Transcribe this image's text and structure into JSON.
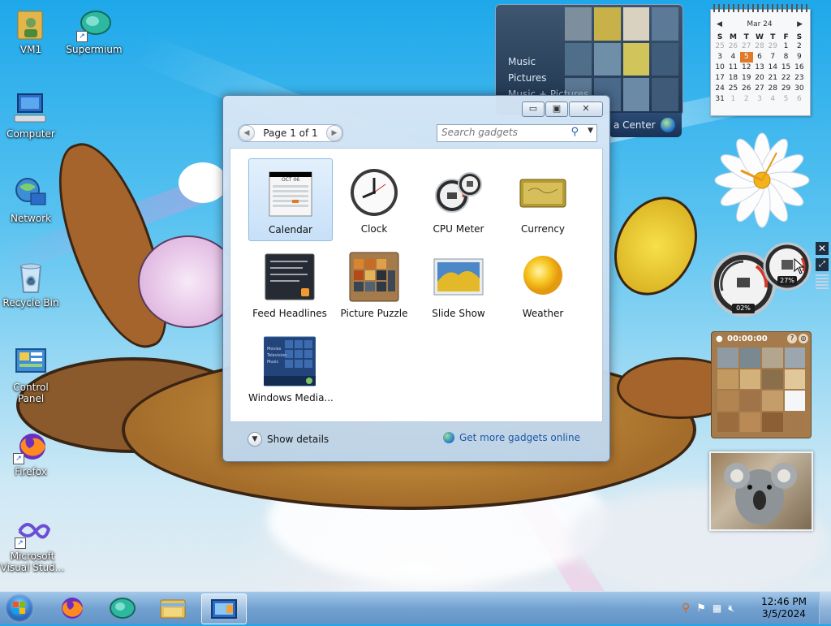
{
  "desktop_icons": [
    {
      "name": "desktop-icon-vm1",
      "label": "VM1"
    },
    {
      "name": "desktop-icon-supermium",
      "label": "Supermium"
    },
    {
      "name": "desktop-icon-computer",
      "label": "Computer"
    },
    {
      "name": "desktop-icon-network",
      "label": "Network"
    },
    {
      "name": "desktop-icon-recycle-bin",
      "label": "Recycle Bin"
    },
    {
      "name": "desktop-icon-control-panel",
      "label": "Control Panel"
    },
    {
      "name": "desktop-icon-firefox",
      "label": "Firefox"
    },
    {
      "name": "desktop-icon-visual-studio",
      "label": "Microsoft Visual Stud..."
    }
  ],
  "media_center_gadget": {
    "items": [
      "Music",
      "Pictures",
      "Music + Pictures"
    ],
    "brand": "a Center"
  },
  "calendar_gadget": {
    "month_label": "Mar 24",
    "weekday_headers": [
      "S",
      "M",
      "T",
      "W",
      "T",
      "F",
      "S"
    ],
    "weeks": [
      [
        "25",
        "26",
        "27",
        "28",
        "29",
        "1",
        "2"
      ],
      [
        "3",
        "4",
        "5",
        "6",
        "7",
        "8",
        "9"
      ],
      [
        "10",
        "11",
        "12",
        "13",
        "14",
        "15",
        "16"
      ],
      [
        "17",
        "18",
        "19",
        "20",
        "21",
        "22",
        "23"
      ],
      [
        "24",
        "25",
        "26",
        "27",
        "28",
        "29",
        "30"
      ],
      [
        "31",
        "1",
        "2",
        "3",
        "4",
        "5",
        "6"
      ]
    ],
    "today": "5"
  },
  "cpu_gadget": {
    "cpu": "02%",
    "memory": "27%"
  },
  "puzzle_gadget": {
    "timer": "00:00:00"
  },
  "gallery": {
    "pager_text": "Page 1 of 1",
    "search_placeholder": "Search gadgets",
    "gadgets": [
      {
        "label": "Calendar",
        "icon": "calendar-icon"
      },
      {
        "label": "Clock",
        "icon": "clock-icon"
      },
      {
        "label": "CPU Meter",
        "icon": "cpu-meter-icon"
      },
      {
        "label": "Currency",
        "icon": "currency-icon"
      },
      {
        "label": "Feed Headlines",
        "icon": "feed-headlines-icon"
      },
      {
        "label": "Picture Puzzle",
        "icon": "picture-puzzle-icon"
      },
      {
        "label": "Slide Show",
        "icon": "slide-show-icon"
      },
      {
        "label": "Weather",
        "icon": "weather-icon"
      },
      {
        "label": "Windows Media...",
        "icon": "windows-media-center-icon"
      }
    ],
    "show_details": "Show details",
    "get_more": "Get more gadgets online",
    "calendar_icon_month": "OCT 06",
    "wmc_icon_lines": [
      "Movies",
      "Television",
      "Music"
    ]
  },
  "taskbar": {
    "time": "12:46 PM",
    "date": "3/5/2024",
    "apps": [
      "Firefox",
      "Supermium",
      "Windows Explorer",
      "Desktop Gadget Gallery"
    ]
  },
  "colors": {
    "accent": "#2a6fc1",
    "today_highlight": "#e07a2a",
    "link": "#1d56a8"
  }
}
